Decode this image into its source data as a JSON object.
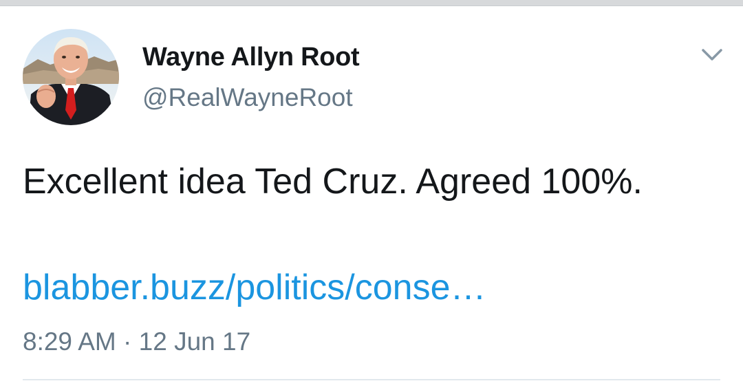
{
  "tweet": {
    "author": {
      "display_name": "Wayne Allyn Root",
      "handle": "@RealWayneRoot"
    },
    "text": "Excellent idea Ted Cruz. Agreed 100%.",
    "link": "blabber.buzz/politics/conse…",
    "timestamp": "8:29 AM · 12 Jun 17",
    "menu_icon": "chevron-down-icon"
  },
  "colors": {
    "name": "#14171a",
    "secondary": "#657786",
    "link": "#1b95e0",
    "divider": "#e1e8ed"
  }
}
